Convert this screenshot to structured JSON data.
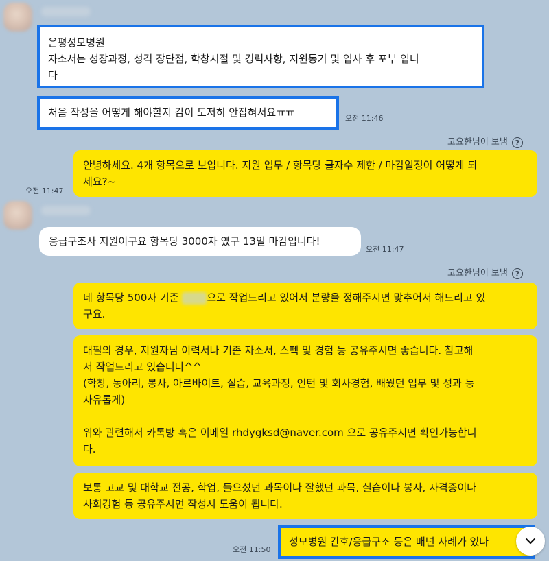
{
  "messages": {
    "m1": {
      "lines": [
        "은평성모병원",
        "자소서는 성장과정, 성격 장단점, 학창시절 및 경력사항, 지원동기 및 입사 후 포부 입니",
        "다"
      ]
    },
    "m2": {
      "text": "처음 작성을 어떻게 해야할지 감이 도저히 안잡혀서요ㅠㅠ",
      "time": "오전 11:46"
    },
    "m3": {
      "sender": "고요한님이 보냄",
      "lines": [
        "안녕하세요. 4개 항목으로 보입니다. 지원 업무 / 항목당 글자수 제한 / 마감일정이 어떻게 되",
        "세요?~"
      ],
      "time": "오전 11:47"
    },
    "m4": {
      "text": "응급구조사 지원이구요 항목당 3000자 였구 13일 마감입니다!",
      "time": "오전 11:47"
    },
    "m5": {
      "sender": "고요한님이 보냄",
      "line1_a": "네 항목당 500자 기준 ",
      "line1_b": "으로 작업드리고 있어서 분량을 정해주시면 맞추어서 해드리고 있",
      "line2": "구요."
    },
    "m6": {
      "lines": [
        "대필의 경우, 지원자님 이력서나 기존 자소서, 스펙 및 경험 등 공유주시면 좋습니다. 참고해",
        "서 작업드리고 있습니다^^",
        "(학창, 동아리, 봉사, 아르바이트, 실습, 교육과정, 인턴 및 회사경험, 배웠던 업무 및 성과 등",
        "자유롭게)",
        "",
        "위와 관련해서 카톡방 혹은 이메일 rhdygksd@naver.com 으로 공유주시면 확인가능합니",
        "다."
      ]
    },
    "m7": {
      "lines": [
        "보통 고교 및 대학교 전공, 학업, 들으셨던 과목이나 잘했던 과목, 실습이나 봉사, 자격증이나",
        "사회경험 등 공유주시면 작성시 도움이 됩니다."
      ]
    },
    "m8": {
      "text": "성모병원 간호/응급구조 등은 매년 사례가 있나",
      "time": "오전 11:50"
    },
    "help_glyph": "?",
    "scroll_icon": "chevron-down-icon",
    "colors": {
      "background": "#b3c6d8",
      "my_bubble": "#fee500",
      "their_bubble": "#ffffff",
      "highlight": "#1a73e8"
    }
  }
}
